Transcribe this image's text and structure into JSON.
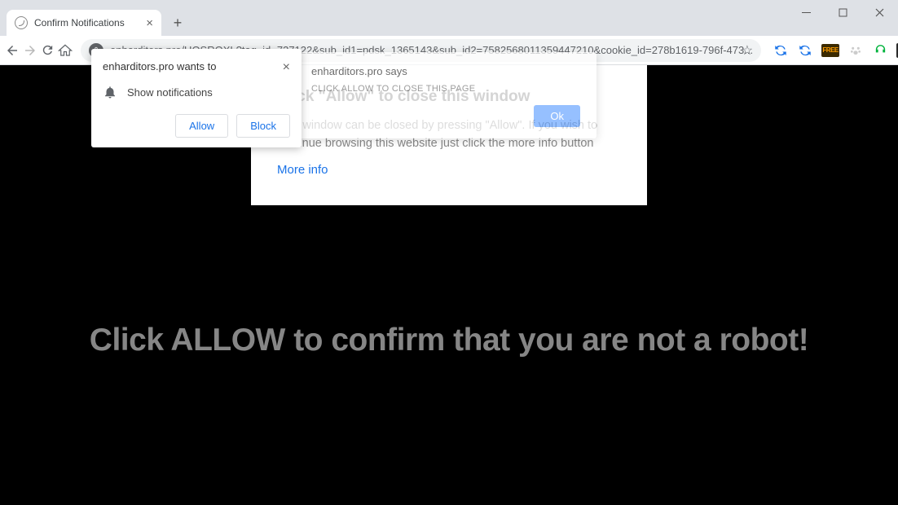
{
  "window": {
    "tab_title": "Confirm Notifications"
  },
  "toolbar": {
    "url": "enharditors.pro/UOSRQXL?tag_id=737122&sub_id1=pdsk_1365143&sub_id2=7582568011359447210&cookie_id=278b1619-796f-473..."
  },
  "perm": {
    "origin": "enharditors.pro wants to",
    "permission": "Show notifications",
    "allow": "Allow",
    "block": "Block"
  },
  "alert": {
    "title": "enharditors.pro says",
    "message": "CLICK ALLOW TO CLOSE THIS PAGE",
    "ok": "Ok"
  },
  "card": {
    "heading": "Click \"Allow\" to close this window",
    "body": "This window can be closed by pressing \"Allow\". If you wish to continue browsing this website just click the more info button",
    "link": "More info"
  },
  "page": {
    "big_text": "Click ALLOW to confirm that you are not a robot!"
  }
}
